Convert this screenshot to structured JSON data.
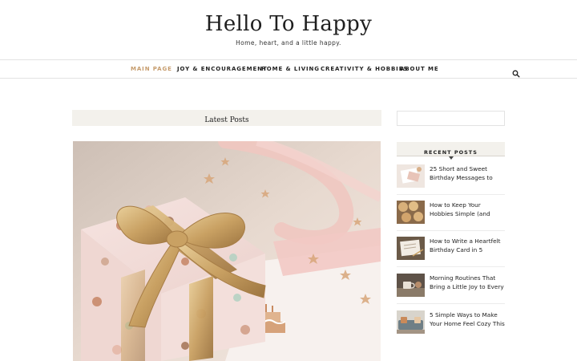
{
  "site": {
    "title": "Hello To Happy",
    "tagline": "Home, heart, and a little happy."
  },
  "nav": {
    "items": [
      {
        "label": "MAIN PAGE",
        "active": true
      },
      {
        "label": "JOY & ENCOURAGEMENT",
        "active": false
      },
      {
        "label": "HOME & LIVING",
        "active": false
      },
      {
        "label": "CREATIVITY & HOBBIES",
        "active": false
      },
      {
        "label": "ABOUT ME",
        "active": false
      }
    ],
    "search_icon": "search-icon"
  },
  "main": {
    "section_title": "Latest Posts",
    "featured_image": "gift-box-with-birthday-card"
  },
  "sidebar": {
    "search_placeholder": "",
    "recent_title": "RECENT POSTS",
    "posts": [
      {
        "title": "25 Short and Sweet Birthday Messages to",
        "thumb": "birthday-card-thumbnail"
      },
      {
        "title": "How to Keep Your Hobbies Simple (and",
        "thumb": "cookies-thumbnail"
      },
      {
        "title": "How to Write a Heartfelt Birthday Card in 5",
        "thumb": "writing-card-thumbnail"
      },
      {
        "title": "Morning Routines That Bring a Little Joy to Every",
        "thumb": "morning-coffee-thumbnail"
      },
      {
        "title": "5 Simple Ways to Make Your Home Feel Cozy This",
        "thumb": "cozy-home-thumbnail"
      }
    ]
  },
  "colors": {
    "accent": "#c69c6d",
    "bar_background": "#f3f1ec",
    "border": "#e3e3e3"
  }
}
